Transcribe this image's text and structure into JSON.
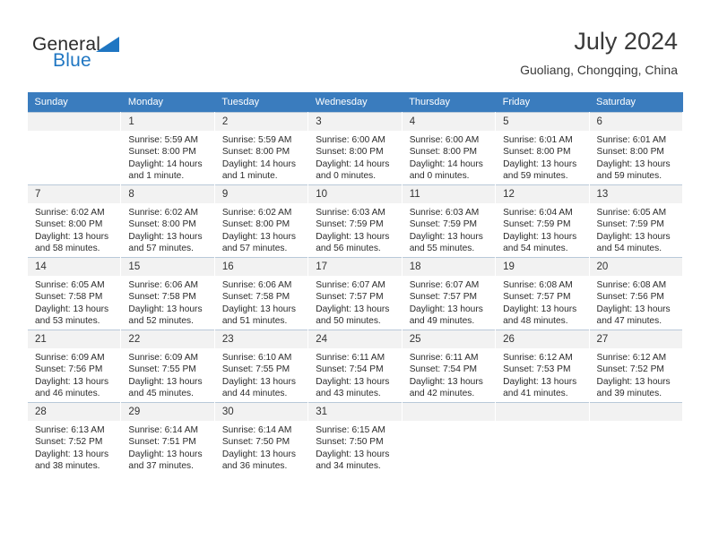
{
  "brand": {
    "line1": "General",
    "line2": "Blue",
    "logo_icon": "blue-triangle-icon",
    "accent_color": "#1f76c2"
  },
  "header": {
    "title": "July 2024",
    "location": "Guoliang, Chongqing, China"
  },
  "calendar": {
    "header_bg": "#3a7cbe",
    "header_text_color": "#ffffff",
    "daynum_bg": "#f2f2f2",
    "weekday_headers": [
      "Sunday",
      "Monday",
      "Tuesday",
      "Wednesday",
      "Thursday",
      "Friday",
      "Saturday"
    ],
    "weeks": [
      [
        {
          "day": "",
          "sunrise": "",
          "sunset": "",
          "daylight1": "",
          "daylight2": ""
        },
        {
          "day": "1",
          "sunrise": "Sunrise: 5:59 AM",
          "sunset": "Sunset: 8:00 PM",
          "daylight1": "Daylight: 14 hours",
          "daylight2": "and 1 minute."
        },
        {
          "day": "2",
          "sunrise": "Sunrise: 5:59 AM",
          "sunset": "Sunset: 8:00 PM",
          "daylight1": "Daylight: 14 hours",
          "daylight2": "and 1 minute."
        },
        {
          "day": "3",
          "sunrise": "Sunrise: 6:00 AM",
          "sunset": "Sunset: 8:00 PM",
          "daylight1": "Daylight: 14 hours",
          "daylight2": "and 0 minutes."
        },
        {
          "day": "4",
          "sunrise": "Sunrise: 6:00 AM",
          "sunset": "Sunset: 8:00 PM",
          "daylight1": "Daylight: 14 hours",
          "daylight2": "and 0 minutes."
        },
        {
          "day": "5",
          "sunrise": "Sunrise: 6:01 AM",
          "sunset": "Sunset: 8:00 PM",
          "daylight1": "Daylight: 13 hours",
          "daylight2": "and 59 minutes."
        },
        {
          "day": "6",
          "sunrise": "Sunrise: 6:01 AM",
          "sunset": "Sunset: 8:00 PM",
          "daylight1": "Daylight: 13 hours",
          "daylight2": "and 59 minutes."
        }
      ],
      [
        {
          "day": "7",
          "sunrise": "Sunrise: 6:02 AM",
          "sunset": "Sunset: 8:00 PM",
          "daylight1": "Daylight: 13 hours",
          "daylight2": "and 58 minutes."
        },
        {
          "day": "8",
          "sunrise": "Sunrise: 6:02 AM",
          "sunset": "Sunset: 8:00 PM",
          "daylight1": "Daylight: 13 hours",
          "daylight2": "and 57 minutes."
        },
        {
          "day": "9",
          "sunrise": "Sunrise: 6:02 AM",
          "sunset": "Sunset: 8:00 PM",
          "daylight1": "Daylight: 13 hours",
          "daylight2": "and 57 minutes."
        },
        {
          "day": "10",
          "sunrise": "Sunrise: 6:03 AM",
          "sunset": "Sunset: 7:59 PM",
          "daylight1": "Daylight: 13 hours",
          "daylight2": "and 56 minutes."
        },
        {
          "day": "11",
          "sunrise": "Sunrise: 6:03 AM",
          "sunset": "Sunset: 7:59 PM",
          "daylight1": "Daylight: 13 hours",
          "daylight2": "and 55 minutes."
        },
        {
          "day": "12",
          "sunrise": "Sunrise: 6:04 AM",
          "sunset": "Sunset: 7:59 PM",
          "daylight1": "Daylight: 13 hours",
          "daylight2": "and 54 minutes."
        },
        {
          "day": "13",
          "sunrise": "Sunrise: 6:05 AM",
          "sunset": "Sunset: 7:59 PM",
          "daylight1": "Daylight: 13 hours",
          "daylight2": "and 54 minutes."
        }
      ],
      [
        {
          "day": "14",
          "sunrise": "Sunrise: 6:05 AM",
          "sunset": "Sunset: 7:58 PM",
          "daylight1": "Daylight: 13 hours",
          "daylight2": "and 53 minutes."
        },
        {
          "day": "15",
          "sunrise": "Sunrise: 6:06 AM",
          "sunset": "Sunset: 7:58 PM",
          "daylight1": "Daylight: 13 hours",
          "daylight2": "and 52 minutes."
        },
        {
          "day": "16",
          "sunrise": "Sunrise: 6:06 AM",
          "sunset": "Sunset: 7:58 PM",
          "daylight1": "Daylight: 13 hours",
          "daylight2": "and 51 minutes."
        },
        {
          "day": "17",
          "sunrise": "Sunrise: 6:07 AM",
          "sunset": "Sunset: 7:57 PM",
          "daylight1": "Daylight: 13 hours",
          "daylight2": "and 50 minutes."
        },
        {
          "day": "18",
          "sunrise": "Sunrise: 6:07 AM",
          "sunset": "Sunset: 7:57 PM",
          "daylight1": "Daylight: 13 hours",
          "daylight2": "and 49 minutes."
        },
        {
          "day": "19",
          "sunrise": "Sunrise: 6:08 AM",
          "sunset": "Sunset: 7:57 PM",
          "daylight1": "Daylight: 13 hours",
          "daylight2": "and 48 minutes."
        },
        {
          "day": "20",
          "sunrise": "Sunrise: 6:08 AM",
          "sunset": "Sunset: 7:56 PM",
          "daylight1": "Daylight: 13 hours",
          "daylight2": "and 47 minutes."
        }
      ],
      [
        {
          "day": "21",
          "sunrise": "Sunrise: 6:09 AM",
          "sunset": "Sunset: 7:56 PM",
          "daylight1": "Daylight: 13 hours",
          "daylight2": "and 46 minutes."
        },
        {
          "day": "22",
          "sunrise": "Sunrise: 6:09 AM",
          "sunset": "Sunset: 7:55 PM",
          "daylight1": "Daylight: 13 hours",
          "daylight2": "and 45 minutes."
        },
        {
          "day": "23",
          "sunrise": "Sunrise: 6:10 AM",
          "sunset": "Sunset: 7:55 PM",
          "daylight1": "Daylight: 13 hours",
          "daylight2": "and 44 minutes."
        },
        {
          "day": "24",
          "sunrise": "Sunrise: 6:11 AM",
          "sunset": "Sunset: 7:54 PM",
          "daylight1": "Daylight: 13 hours",
          "daylight2": "and 43 minutes."
        },
        {
          "day": "25",
          "sunrise": "Sunrise: 6:11 AM",
          "sunset": "Sunset: 7:54 PM",
          "daylight1": "Daylight: 13 hours",
          "daylight2": "and 42 minutes."
        },
        {
          "day": "26",
          "sunrise": "Sunrise: 6:12 AM",
          "sunset": "Sunset: 7:53 PM",
          "daylight1": "Daylight: 13 hours",
          "daylight2": "and 41 minutes."
        },
        {
          "day": "27",
          "sunrise": "Sunrise: 6:12 AM",
          "sunset": "Sunset: 7:52 PM",
          "daylight1": "Daylight: 13 hours",
          "daylight2": "and 39 minutes."
        }
      ],
      [
        {
          "day": "28",
          "sunrise": "Sunrise: 6:13 AM",
          "sunset": "Sunset: 7:52 PM",
          "daylight1": "Daylight: 13 hours",
          "daylight2": "and 38 minutes."
        },
        {
          "day": "29",
          "sunrise": "Sunrise: 6:14 AM",
          "sunset": "Sunset: 7:51 PM",
          "daylight1": "Daylight: 13 hours",
          "daylight2": "and 37 minutes."
        },
        {
          "day": "30",
          "sunrise": "Sunrise: 6:14 AM",
          "sunset": "Sunset: 7:50 PM",
          "daylight1": "Daylight: 13 hours",
          "daylight2": "and 36 minutes."
        },
        {
          "day": "31",
          "sunrise": "Sunrise: 6:15 AM",
          "sunset": "Sunset: 7:50 PM",
          "daylight1": "Daylight: 13 hours",
          "daylight2": "and 34 minutes."
        },
        {
          "day": "",
          "sunrise": "",
          "sunset": "",
          "daylight1": "",
          "daylight2": ""
        },
        {
          "day": "",
          "sunrise": "",
          "sunset": "",
          "daylight1": "",
          "daylight2": ""
        },
        {
          "day": "",
          "sunrise": "",
          "sunset": "",
          "daylight1": "",
          "daylight2": ""
        }
      ]
    ]
  }
}
